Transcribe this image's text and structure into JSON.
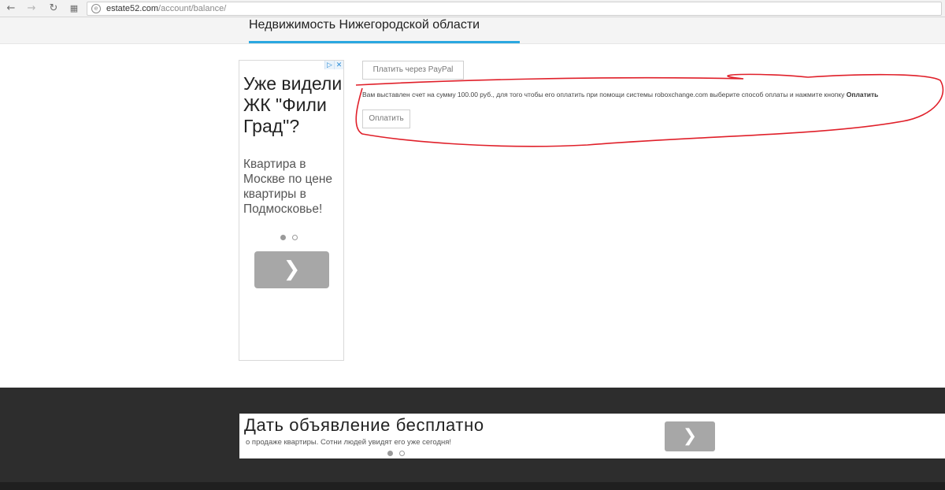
{
  "browser": {
    "url_host": "estate52.com",
    "url_path": "/account/balance/",
    "icons": [
      "back-arrow-icon",
      "forward-arrow-icon",
      "reload-icon",
      "apps-grid-icon",
      "site-info-icon"
    ]
  },
  "header": {
    "site_title": "Недвижимость Нижегородской области",
    "accent_color": "#2aa7e0"
  },
  "side_ad": {
    "headline": "Уже видели ЖК \"Фили Град\"?",
    "body": "Квартира в Москве по цене квартиры в Подмосковье!",
    "corner_icons": [
      "adchoices-icon",
      "close-icon"
    ],
    "slides_total": 2,
    "active_slide": 1
  },
  "payment": {
    "paypal_button": "Платить через PayPal",
    "invoice_text": "Вам выставлен счет на сумму 100.00 руб., для того чтобы его оплатить при помощи системы roboxchange.com выберите способ оплаты и нажмите кнопку ",
    "invoice_bold": "Оплатить",
    "pay_button": "Оплатить",
    "highlight_color": "#e0202a"
  },
  "bottom_ad": {
    "title": "Дать объявление бесплатно",
    "subtitle": "о продаже квартиры. Сотни людей увидят его уже сегодня!",
    "slides_total": 2,
    "active_slide": 1
  },
  "footer": {
    "background": "#2d2d2d"
  }
}
